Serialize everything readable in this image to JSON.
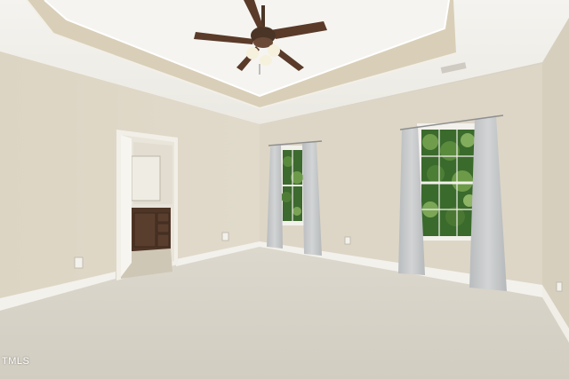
{
  "photo": {
    "watermark": "TMLS",
    "subject": "empty-bedroom-interior",
    "colors": {
      "wall": "#ddd6c6",
      "wall_right": "#d6cfbe",
      "ceiling": "#f1efe9",
      "carpet": "#d6d2c7",
      "trim": "#f3f1ec",
      "curtain": "#c5c7c8",
      "foliage": "#3d6a2e",
      "vanity": "#4e3526"
    },
    "icons": [
      "ceiling-fan-icon",
      "window-icon",
      "curtain-icon",
      "doorway-icon",
      "outlet-icon",
      "vent-icon"
    ]
  }
}
